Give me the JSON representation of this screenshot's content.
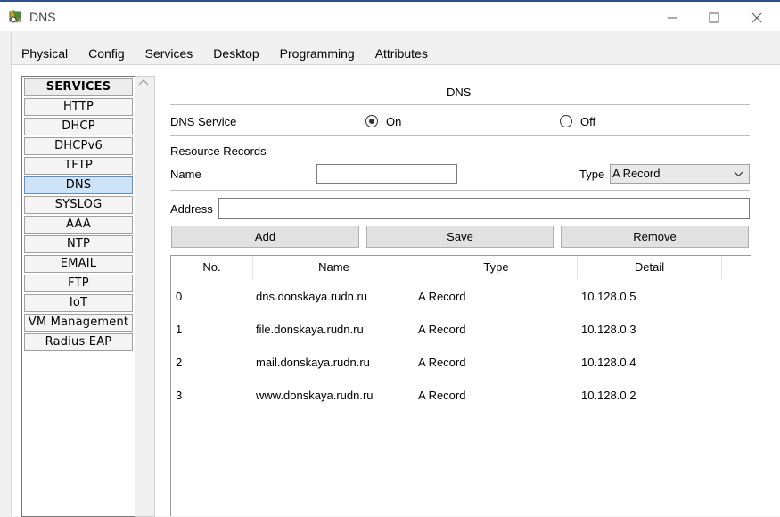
{
  "window": {
    "title": "DNS"
  },
  "tabs": [
    "Physical",
    "Config",
    "Services",
    "Desktop",
    "Programming",
    "Attributes"
  ],
  "active_tab": "Services",
  "services": {
    "header": "SERVICES",
    "items": [
      "HTTP",
      "DHCP",
      "DHCPv6",
      "TFTP",
      "DNS",
      "SYSLOG",
      "AAA",
      "NTP",
      "EMAIL",
      "FTP",
      "IoT",
      "VM Management",
      "Radius EAP"
    ],
    "selected": "DNS"
  },
  "panel": {
    "title": "DNS",
    "service_label": "DNS Service",
    "on_label": "On",
    "off_label": "Off",
    "service_state": "On",
    "records_label": "Resource Records",
    "name_label": "Name",
    "name_value": "",
    "type_label": "Type",
    "type_value": "A Record",
    "address_label": "Address",
    "address_value": "",
    "buttons": {
      "add": "Add",
      "save": "Save",
      "remove": "Remove"
    }
  },
  "table": {
    "columns": [
      "No.",
      "Name",
      "Type",
      "Detail"
    ],
    "rows": [
      [
        "0",
        "dns.donskaya.rudn.ru",
        "A Record",
        "10.128.0.5"
      ],
      [
        "1",
        "file.donskaya.rudn.ru",
        "A Record",
        "10.128.0.3"
      ],
      [
        "2",
        "mail.donskaya.rudn.ru",
        "A Record",
        "10.128.0.4"
      ],
      [
        "3",
        "www.donskaya.rudn.ru",
        "A Record",
        "10.128.0.2"
      ]
    ]
  }
}
